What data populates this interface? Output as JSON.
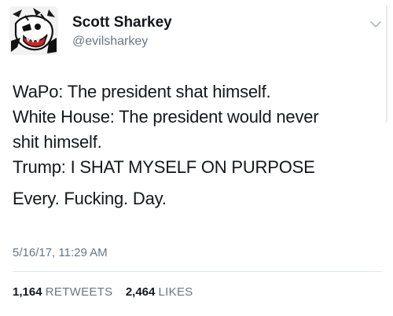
{
  "author": {
    "name": "Scott Sharkey",
    "handle": "@evilsharkey"
  },
  "tweet": {
    "lines": [
      "WaPo: The president shat himself.",
      "White House: The president would never",
      "shit himself.",
      "Trump: I SHAT MYSELF ON PURPOSE",
      "Every. Fucking. Day."
    ],
    "timestamp": "5/16/17, 11:29 AM"
  },
  "stats": {
    "retweets_count": "1,164",
    "retweets_label": "RETWEETS",
    "likes_count": "2,464",
    "likes_label": "LIKES"
  },
  "icons": {
    "menu": "chevron-down-icon"
  },
  "colors": {
    "text": "#14171a",
    "secondary": "#657786",
    "divider": "#e1e8ed"
  }
}
